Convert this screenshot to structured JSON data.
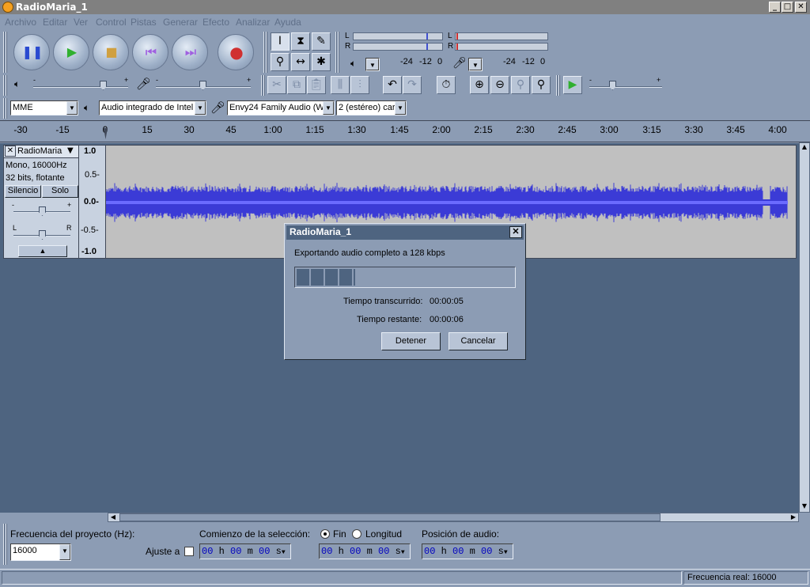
{
  "window": {
    "title": "RadioMaria_1",
    "min": "_",
    "max": "□",
    "close": "✕"
  },
  "menu": [
    "Archivo",
    "Editar",
    "Ver",
    "Control",
    "Pistas",
    "Generar",
    "Efecto",
    "Analizar",
    "Ayuda"
  ],
  "meters": {
    "out_L": "L",
    "out_R": "R",
    "in_L": "L",
    "in_R": "R",
    "out_scale": [
      "-24",
      "-12",
      "0"
    ],
    "in_scale": [
      "-24",
      "-12",
      "0"
    ]
  },
  "mixer": {
    "minus": "-",
    "plus": "+"
  },
  "devices": {
    "host": "MME",
    "output": "Audio integrado de Intel",
    "input": "Envy24 Family Audio (WI",
    "channels": "2 (estéreo) car"
  },
  "ruler": [
    "-30",
    "-15",
    "0",
    "15",
    "30",
    "45",
    "1:00",
    "1:15",
    "1:30",
    "1:45",
    "2:00",
    "2:15",
    "2:30",
    "2:45",
    "3:00",
    "3:15",
    "3:30",
    "3:45",
    "4:00"
  ],
  "track": {
    "name": "RadioMaria",
    "info1": "Mono, 16000Hz",
    "info2": "32 bits, flotante",
    "mute": "Silencio",
    "solo": "Solo",
    "gain_minus": "-",
    "gain_plus": "+",
    "pan_l": "L",
    "pan_r": "R",
    "scale": [
      "1.0",
      "0.5-",
      "0.0-",
      "-0.5-",
      "-1.0"
    ],
    "close": "✕"
  },
  "dialog": {
    "title": "RadioMaria_1",
    "message": "Exportando audio completo a 128 kbps",
    "progress": 0.27,
    "elapsed_label": "Tiempo transcurrido:",
    "elapsed_value": "00:00:05",
    "remaining_label": "Tiempo restante:",
    "remaining_value": "00:00:06",
    "stop": "Detener",
    "cancel": "Cancelar",
    "close": "✕"
  },
  "bottom": {
    "rate_label": "Frecuencia del proyecto (Hz):",
    "rate_value": "16000",
    "snap_label": "Ajuste a",
    "sel_label": "Comienzo de la selección:",
    "end_label": "Fin",
    "length_label": "Longitud",
    "pos_label": "Posición de audio:",
    "time1": {
      "h": "00",
      "m": "00",
      "s": "00"
    },
    "time2": {
      "h": "00",
      "m": "00",
      "s": "00"
    },
    "time3": {
      "h": "00",
      "m": "00",
      "s": "00"
    },
    "unit_h": "h",
    "unit_m": "m",
    "unit_s": "s"
  },
  "status": {
    "rate": "Frecuencia real: 16000"
  },
  "colors": {
    "wave": "#3b3bd6",
    "background": "#8c9cb4",
    "workarea": "#4e6480"
  }
}
